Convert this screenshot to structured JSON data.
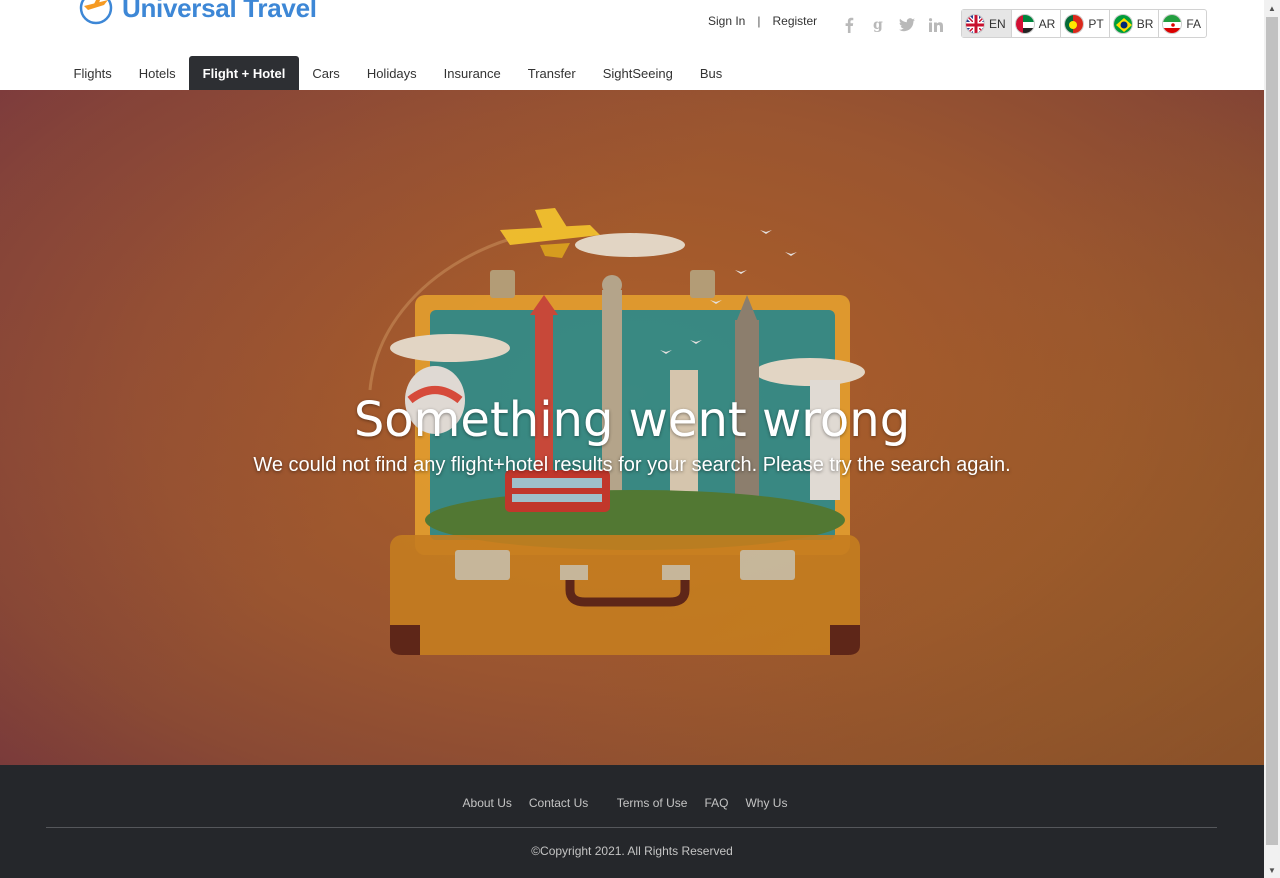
{
  "brand": {
    "name": "Universal Travel"
  },
  "auth": {
    "sign_in": "Sign In",
    "separator": "|",
    "register": "Register"
  },
  "social": [
    {
      "icon": "facebook-icon",
      "glyph": "f"
    },
    {
      "icon": "google-icon",
      "glyph": "g"
    },
    {
      "icon": "twitter-icon",
      "glyph": "t"
    },
    {
      "icon": "linkedin-icon",
      "glyph": "in"
    }
  ],
  "languages": [
    {
      "code": "EN",
      "flag": "uk-flag-icon",
      "active": true
    },
    {
      "code": "AR",
      "flag": "uae-flag-icon",
      "active": false
    },
    {
      "code": "PT",
      "flag": "portugal-flag-icon",
      "active": false
    },
    {
      "code": "BR",
      "flag": "brazil-flag-icon",
      "active": false
    },
    {
      "code": "FA",
      "flag": "iran-flag-icon",
      "active": false
    }
  ],
  "nav": [
    {
      "label": "Flights",
      "active": false
    },
    {
      "label": "Hotels",
      "active": false
    },
    {
      "label": "Flight + Hotel",
      "active": true
    },
    {
      "label": "Cars",
      "active": false
    },
    {
      "label": "Holidays",
      "active": false
    },
    {
      "label": "Insurance",
      "active": false
    },
    {
      "label": "Transfer",
      "active": false
    },
    {
      "label": "SightSeeing",
      "active": false
    },
    {
      "label": "Bus",
      "active": false
    }
  ],
  "hero": {
    "title": "Something went wrong",
    "subtitle": "We could not find any flight+hotel results for your search. Please try the search again."
  },
  "footer": {
    "links": [
      "About Us",
      "Contact Us",
      "Terms of Use",
      "FAQ",
      "Why Us"
    ],
    "copyright": "©Copyright 2021. All Rights Reserved"
  },
  "colors": {
    "brand": "#3d87d6",
    "nav_active_bg": "#2d2f33",
    "footer_bg": "#25272b"
  }
}
